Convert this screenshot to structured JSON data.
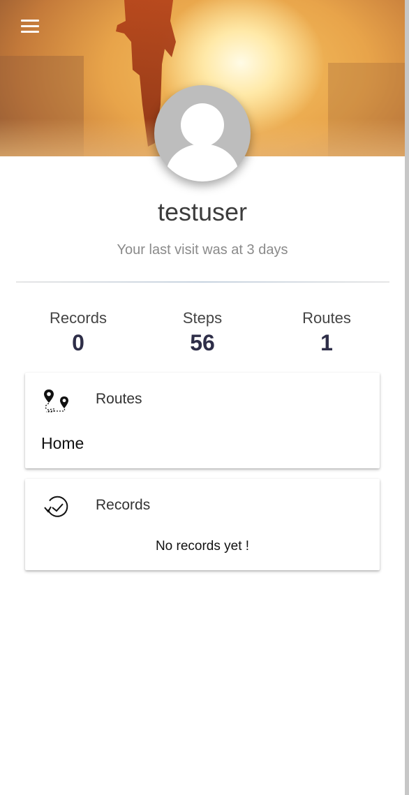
{
  "header": {
    "menu_icon": "hamburger-menu-icon",
    "hero_image": "runner-sunrise-photo"
  },
  "profile": {
    "avatar_icon": "default-user-avatar-icon",
    "username": "testuser",
    "last_visit": "Your last visit was at 3 days"
  },
  "stats": [
    {
      "label": "Records",
      "value": "0"
    },
    {
      "label": "Steps",
      "value": "56"
    },
    {
      "label": "Routes",
      "value": "1"
    }
  ],
  "routes_card": {
    "icon": "route-map-pins-icon",
    "title": "Routes",
    "items": [
      "Home"
    ]
  },
  "records_card": {
    "icon": "history-clock-icon",
    "title": "Records",
    "empty_text": "No records yet !"
  },
  "colors": {
    "stat_value": "#2e2e48",
    "username": "#3c3c3c",
    "muted_text": "#8a8a8a"
  }
}
